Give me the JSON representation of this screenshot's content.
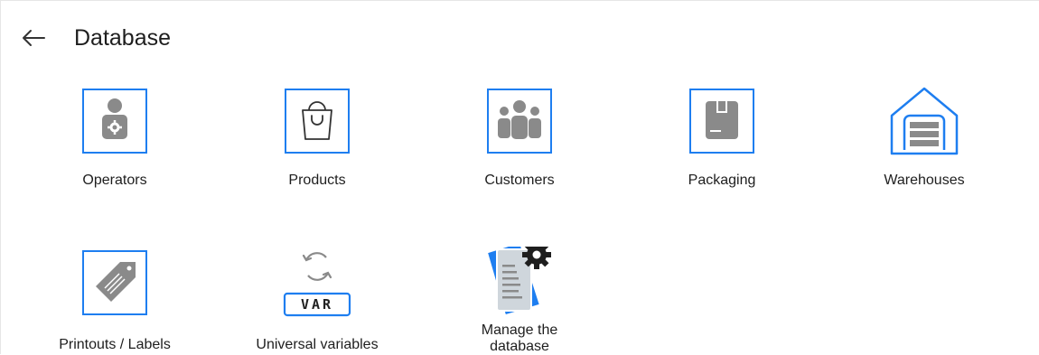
{
  "header": {
    "title": "Database",
    "back_icon": "arrow-left-icon"
  },
  "tiles": [
    {
      "label": "Operators",
      "icon": "operator-icon"
    },
    {
      "label": "Products",
      "icon": "shopping-bag-icon"
    },
    {
      "label": "Customers",
      "icon": "customers-group-icon"
    },
    {
      "label": "Packaging",
      "icon": "package-box-icon"
    },
    {
      "label": "Warehouses",
      "icon": "warehouse-icon"
    },
    {
      "label": "Printouts / Labels",
      "icon": "tag-label-icon"
    },
    {
      "label": "Universal variables",
      "icon": "var-refresh-icon",
      "badge": "VAR"
    },
    {
      "label_line1": "Manage the",
      "label_line2": "database",
      "icon": "manage-database-icon"
    }
  ],
  "colors": {
    "accent": "#1e7ef0",
    "icon_gray": "#8a8a8a",
    "text": "#1e1e1e"
  }
}
